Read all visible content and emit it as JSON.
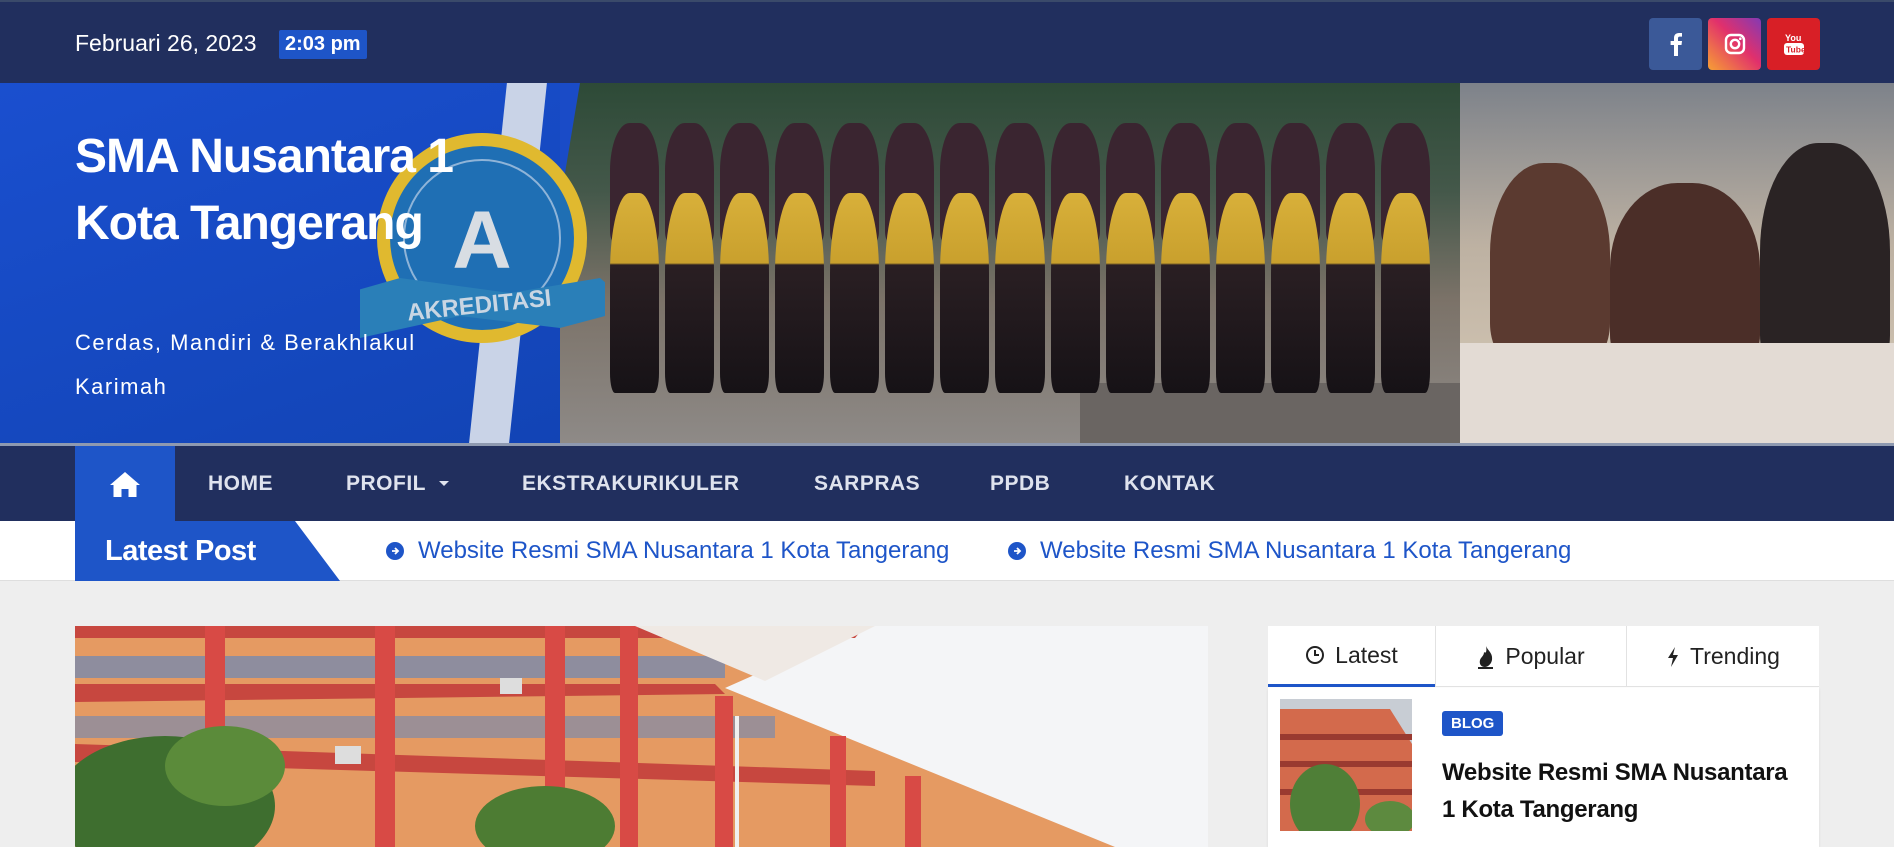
{
  "topbar": {
    "date": "Februari 26, 2023",
    "time": "2:03 pm",
    "social": [
      {
        "name": "facebook",
        "icon": "facebook-icon",
        "color": "#3b5998"
      },
      {
        "name": "instagram",
        "icon": "instagram-icon",
        "color": "#e1306c"
      },
      {
        "name": "youtube",
        "icon": "youtube-icon",
        "color": "#d81f26"
      }
    ]
  },
  "header": {
    "title": "SMA Nusantara 1 Kota Tangerang",
    "tagline": "Cerdas, Mandiri & Berakhlakul Karimah",
    "badge_letter": "A",
    "badge_text": "AKREDITASI"
  },
  "nav": {
    "home_icon": "home-icon",
    "items": [
      {
        "label": "HOME"
      },
      {
        "label": "PROFIL",
        "has_dropdown": true
      },
      {
        "label": "EKSTRAKURIKULER"
      },
      {
        "label": "SARPRAS"
      },
      {
        "label": "PPDB"
      },
      {
        "label": "KONTAK"
      }
    ]
  },
  "ticker": {
    "label": "Latest Post",
    "items": [
      "Website Resmi SMA Nusantara 1 Kota Tangerang",
      "Website Resmi SMA Nusantara 1 Kota Tangerang"
    ]
  },
  "sidebar": {
    "tabs": [
      {
        "label": "Latest",
        "icon": "clock-icon",
        "active": true
      },
      {
        "label": "Popular",
        "icon": "fire-icon",
        "active": false
      },
      {
        "label": "Trending",
        "icon": "bolt-icon",
        "active": false
      }
    ],
    "post": {
      "category": "BLOG",
      "title": "Website Resmi SMA Nusantara 1 Kota Tangerang"
    }
  },
  "colors": {
    "navy": "#212f5e",
    "accent": "#1e55c8"
  }
}
